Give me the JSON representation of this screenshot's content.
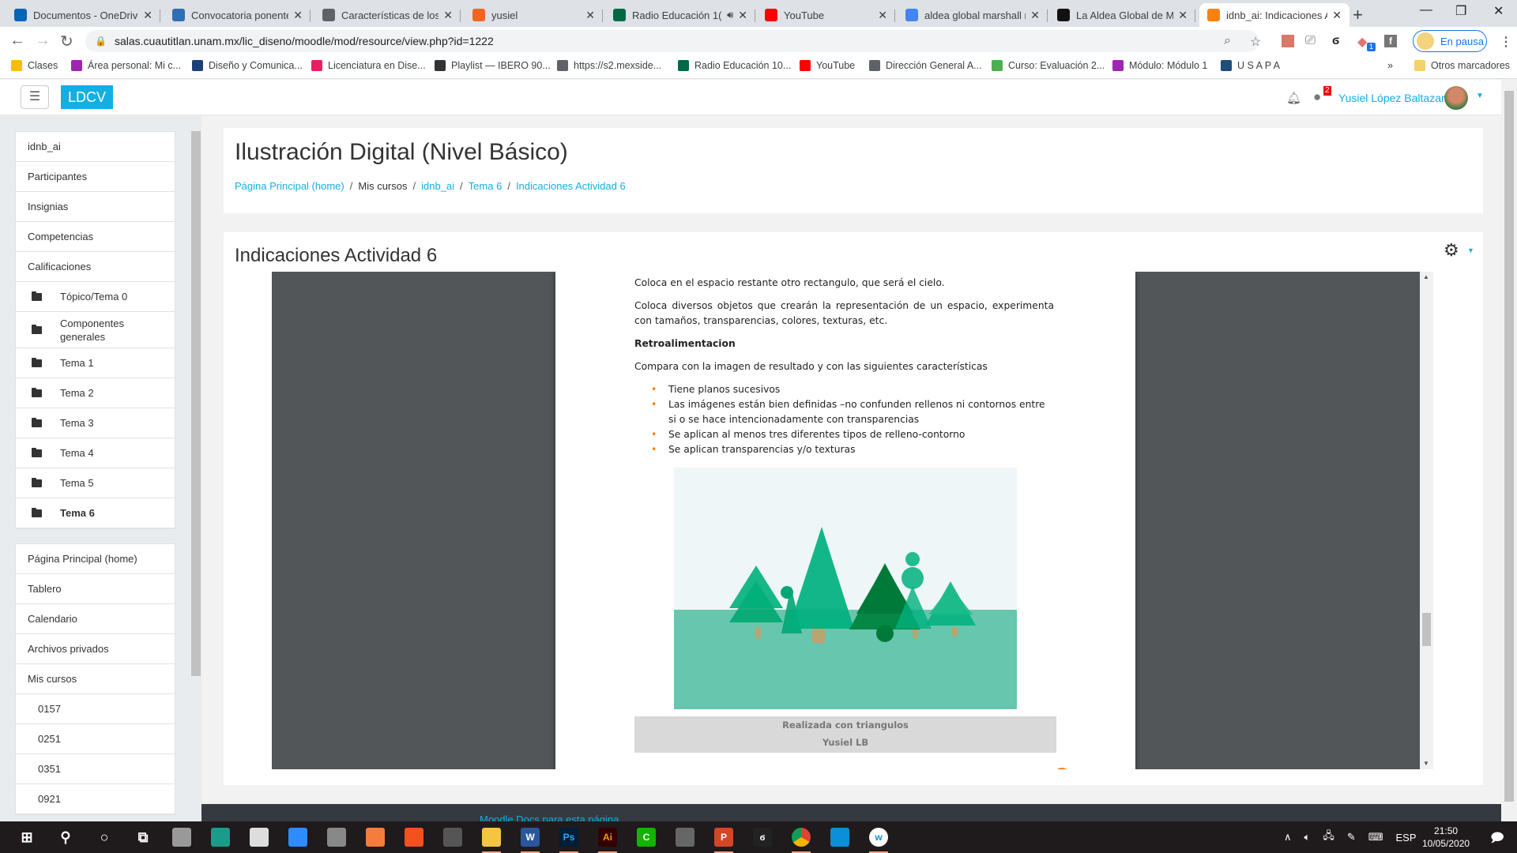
{
  "browser": {
    "tabs": [
      {
        "title": "Documentos - OneDrive",
        "icon": "onedrive-icon",
        "color": "#0364b8"
      },
      {
        "title": "Convocatoria ponentes",
        "icon": "unam-icon",
        "color": "#2f6db5"
      },
      {
        "title": "Características de los tr",
        "icon": "globe-icon",
        "color": "#5f6368"
      },
      {
        "title": "yusiel",
        "icon": "smile-icon",
        "color": "#f26522"
      },
      {
        "title": "Radio Educación 1(",
        "icon": "mexico-flag-icon",
        "color": "#006847",
        "audio": true
      },
      {
        "title": "YouTube",
        "icon": "youtube-icon",
        "color": "#ff0000"
      },
      {
        "title": "aldea global marshall n",
        "icon": "google-icon",
        "color": "#4285f4"
      },
      {
        "title": "La Aldea Global de Mar",
        "icon": "f-icon",
        "color": "#111111"
      },
      {
        "title": "idnb_ai: Indicaciones A",
        "icon": "moodle-icon",
        "color": "#f98012",
        "active": true
      }
    ],
    "url": "salas.cuautitlan.unam.mx/lic_diseno/moodle/mod/resource/view.php?id=1222",
    "profile_label": "En pausa",
    "extension_badge": "1",
    "bookmarks": [
      {
        "label": "Clases",
        "color": "#fbbc04"
      },
      {
        "label": "Área personal: Mi c...",
        "color": "#9c27b0"
      },
      {
        "label": "Diseño y Comunica...",
        "color": "#1c3f7a"
      },
      {
        "label": "Licenciatura en Dise...",
        "color": "#e91e63"
      },
      {
        "label": "Playlist — IBERO 90...",
        "color": "#333333"
      },
      {
        "label": "https://s2.mexside...",
        "color": "#5f6368"
      },
      {
        "label": "Radio Educación 10...",
        "color": "#006847"
      },
      {
        "label": "YouTube",
        "color": "#ff0000"
      },
      {
        "label": "Dirección General A...",
        "color": "#5f6368"
      },
      {
        "label": "Curso: Evaluación 2...",
        "color": "#4caf50"
      },
      {
        "label": "Módulo: Módulo 1",
        "color": "#9c27b0"
      },
      {
        "label": "U S A P A",
        "color": "#1e4e79"
      }
    ],
    "more_bookmarks": "»",
    "other_bookmarks": "Otros marcadores"
  },
  "navbar": {
    "menu_icon": "☰",
    "brand": "LDCV",
    "message_count": "2",
    "user_name": "Yusiel López Baltazar"
  },
  "sidebar": {
    "course_items": [
      {
        "label": "idnb_ai"
      },
      {
        "label": "Participantes"
      },
      {
        "label": "Insignias"
      },
      {
        "label": "Competencias"
      },
      {
        "label": "Calificaciones"
      },
      {
        "label": "Tópico/Tema 0",
        "folder": true
      },
      {
        "label": "Componentes generales",
        "folder": true
      },
      {
        "label": "Tema 1",
        "folder": true
      },
      {
        "label": "Tema 2",
        "folder": true
      },
      {
        "label": "Tema 3",
        "folder": true
      },
      {
        "label": "Tema 4",
        "folder": true
      },
      {
        "label": "Tema 5",
        "folder": true
      },
      {
        "label": "Tema 6",
        "folder": true,
        "current": true
      }
    ],
    "site_items": [
      {
        "label": "Página Principal (home)"
      },
      {
        "label": "Tablero"
      },
      {
        "label": "Calendario"
      },
      {
        "label": "Archivos privados"
      },
      {
        "label": "Mis cursos"
      },
      {
        "label": "0157"
      },
      {
        "label": "0251"
      },
      {
        "label": "0351"
      },
      {
        "label": "0921"
      }
    ]
  },
  "header": {
    "course_title": "Ilustración Digital (Nivel Básico)",
    "breadcrumb": [
      {
        "label": "Página Principal (home)",
        "link": true
      },
      {
        "label": "Mis cursos",
        "link": false
      },
      {
        "label": "idnb_ai",
        "link": true
      },
      {
        "label": "Tema 6",
        "link": true
      },
      {
        "label": "Indicaciones Actividad 6",
        "link": true
      }
    ]
  },
  "activity": {
    "title": "Indicaciones Actividad 6",
    "pdf": {
      "para1": "Coloca en el espacio restante otro rectangulo, que será el cielo.",
      "para2": "Coloca diversos objetos que crearán la representación de un espacio, experimenta con tamaños, transparencias, colores, texturas, etc.",
      "heading": "Retroalimentacion",
      "para3": "Compara con la imagen de resultado y con las siguientes características",
      "bullets": [
        "Tiene planos sucesivos",
        "Las imágenes están bien definidas –no confunden rellenos ni contornos entre si o se hace intencionadamente con transparencias",
        "Se aplican al menos tres diferentes tipos de relleno-contorno",
        "Se aplican transparencias y/o texturas"
      ],
      "caption_line1": "Realizada con triangulos",
      "caption_line2": "Yusiel LB",
      "scroll_position": 0.72
    }
  },
  "footer": {
    "docs_link": "Moodle Docs para esta página"
  },
  "taskbar": {
    "apps": [
      "windows-start-icon",
      "search-icon",
      "cortana-icon",
      "task-view-icon",
      "app-swirl-icon",
      "app-green-icon",
      "microphone-icon",
      "zoom-icon",
      "clapper-icon",
      "recorder-icon",
      "app-orange-icon",
      "obs-icon",
      "file-explorer-icon",
      "word-icon",
      "photoshop-icon",
      "illustrator-icon",
      "camtasia-icon",
      "app-clock-icon",
      "powerpoint-pdf-icon",
      "app-flame-icon",
      "chrome-icon",
      "edge-icon",
      "app-w-icon"
    ],
    "language": "ESP",
    "time": "21:50",
    "date": "10/05/2020"
  }
}
